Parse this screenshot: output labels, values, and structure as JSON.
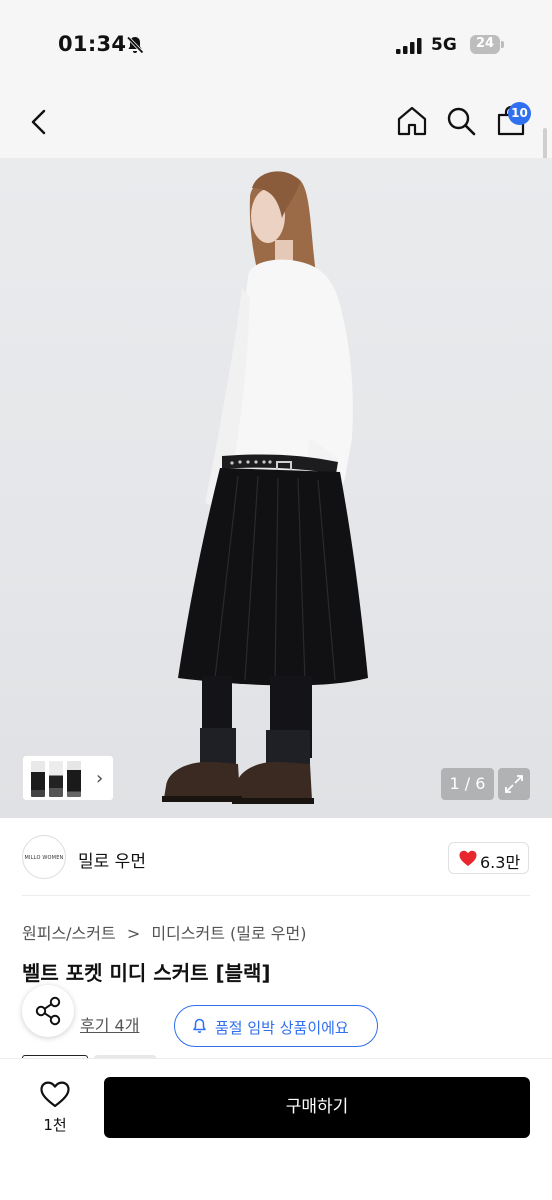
{
  "status_bar": {
    "time": "01:34",
    "network": "5G",
    "battery": "24"
  },
  "nav": {
    "cart_count": "10"
  },
  "gallery": {
    "page_indicator": "1 / 6"
  },
  "brand": {
    "logo_text": "MILLO WOMEN",
    "name": "밀로 우먼",
    "likes": "6.3만"
  },
  "product": {
    "breadcrumb": [
      "원피스/스커트",
      ">",
      "미디스커트 (밀로 우먼)"
    ],
    "title": "벨트 포켓 미디 스커트 [블랙]",
    "reviews": "후기 4개",
    "stock_notice": "품절 임박 상품이에요"
  },
  "bottom_bar": {
    "wish_count": "1천",
    "buy_label": "구매하기"
  },
  "colors": {
    "accent_blue": "#2f6ff0",
    "heart_red": "#e8262e",
    "buy_button": "#000000"
  }
}
